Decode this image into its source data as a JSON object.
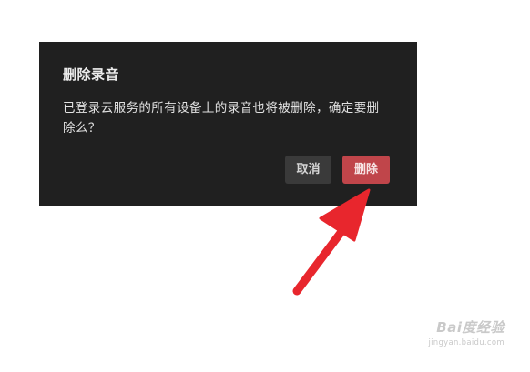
{
  "dialog": {
    "title": "删除录音",
    "message": "已登录云服务的所有设备上的录音也将被删除，确定要删除么？",
    "cancel_label": "取消",
    "delete_label": "删除"
  },
  "annotation": {
    "arrow_color": "#e8262d",
    "icon": "red-arrow-icon"
  },
  "watermark": {
    "logo_text": "Bai度经验",
    "url_text": "jingyan.baidu.com"
  },
  "colors": {
    "dialog_bg": "#202020",
    "cancel_bg": "#3a3a3a",
    "delete_bg": "#c0454a"
  }
}
